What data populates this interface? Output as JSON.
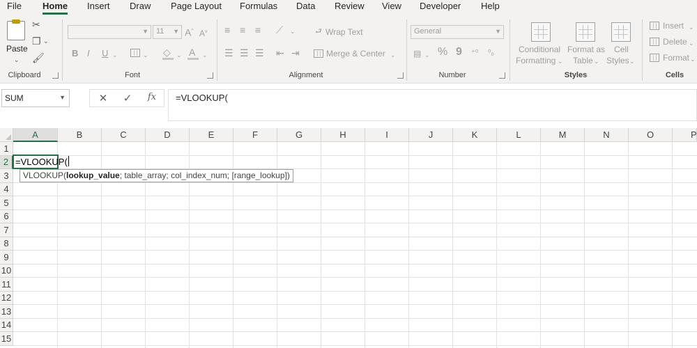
{
  "tabs": [
    "File",
    "Home",
    "Insert",
    "Draw",
    "Page Layout",
    "Formulas",
    "Data",
    "Review",
    "View",
    "Developer",
    "Help"
  ],
  "active_tab": "Home",
  "ribbon": {
    "clipboard": {
      "paste_label": "Paste",
      "group_label": "Clipboard"
    },
    "font": {
      "font_name": "",
      "font_size": "11",
      "bold": "B",
      "italic": "I",
      "underline": "U",
      "group_label": "Font"
    },
    "alignment": {
      "wrap_text": "Wrap Text",
      "merge_center": "Merge & Center",
      "group_label": "Alignment"
    },
    "number": {
      "format": "General",
      "percent": "%",
      "comma": "9",
      "group_label": "Number"
    },
    "styles": {
      "conditional_line1": "Conditional",
      "conditional_line2": "Formatting",
      "format_as_line1": "Format as",
      "format_as_line2": "Table",
      "cell_styles_line1": "Cell",
      "cell_styles_line2": "Styles",
      "group_label": "Styles"
    },
    "cells": {
      "insert": "Insert",
      "delete": "Delete",
      "format": "Format",
      "group_label": "Cells"
    }
  },
  "formula_bar": {
    "name_box": "SUM",
    "cancel": "✕",
    "enter": "✓",
    "fx": "fx",
    "content": "=VLOOKUP("
  },
  "grid": {
    "columns": [
      "A",
      "B",
      "C",
      "D",
      "E",
      "F",
      "G",
      "H",
      "I",
      "J",
      "K",
      "L",
      "M",
      "N",
      "O",
      "P"
    ],
    "rows": [
      "1",
      "2",
      "3",
      "4",
      "5",
      "6",
      "7",
      "8",
      "9",
      "10",
      "11",
      "12",
      "13",
      "14",
      "15"
    ],
    "active_cell_text": "=VLOOKUP(",
    "tooltip": {
      "func": "VLOOKUP(",
      "arg1": "lookup_value",
      "rest": "; table_array; col_index_num; [range_lookup])"
    }
  },
  "colors": {
    "accent": "#217346",
    "ribbon_bg": "#f3f2f1",
    "gridline": "#e1e1e1"
  }
}
